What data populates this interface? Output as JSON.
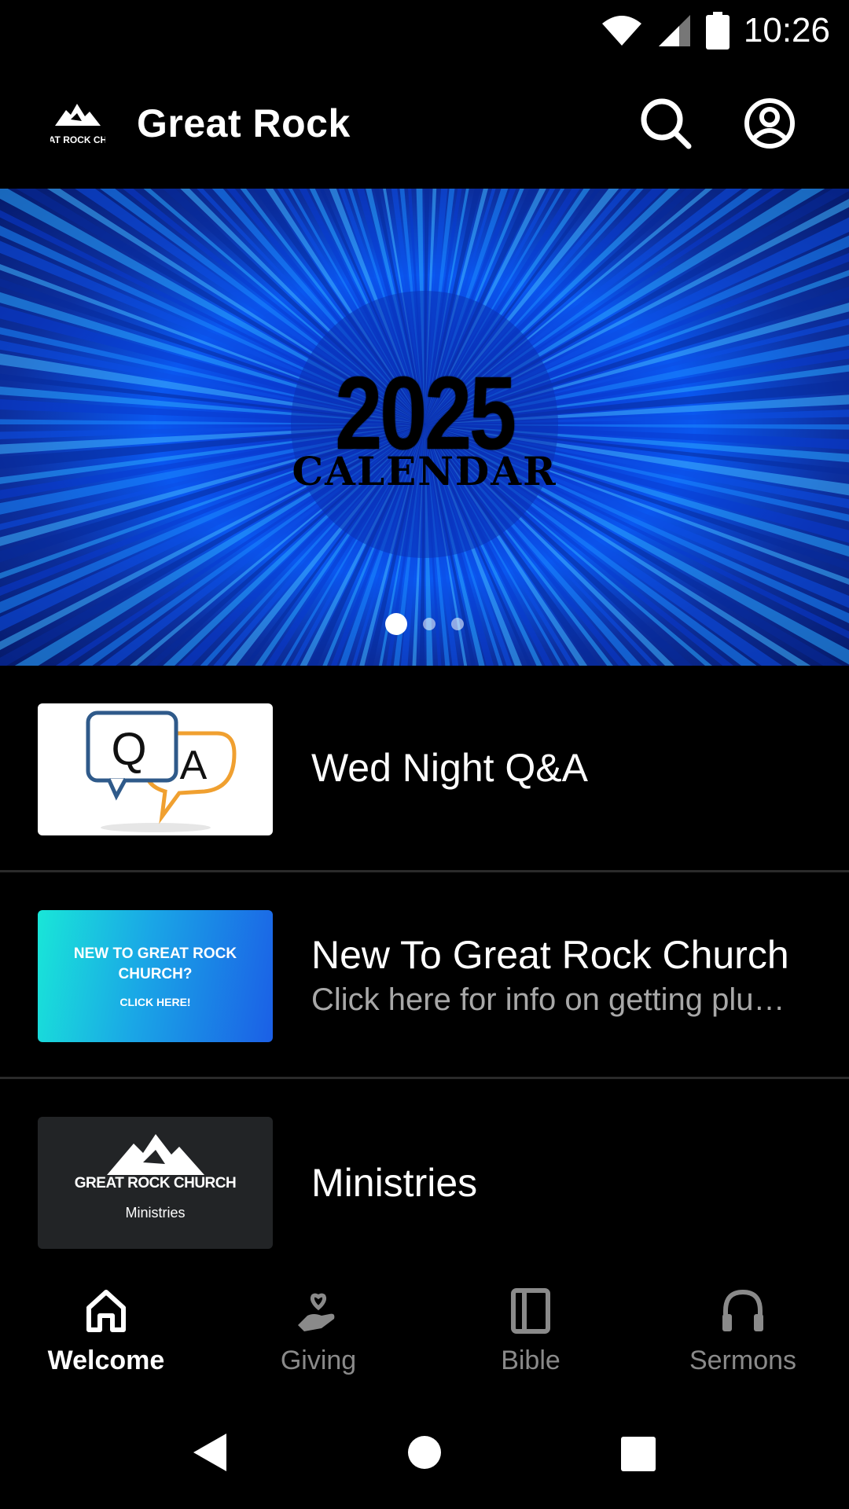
{
  "status_bar": {
    "time": "10:26"
  },
  "app_bar": {
    "title": "Great Rock",
    "logo_text": "AT ROCK CH"
  },
  "hero": {
    "year": "2025",
    "subtitle": "CALENDAR",
    "page_count": 3,
    "active_page": 1
  },
  "list": [
    {
      "title": "Wed Night Q&A",
      "subtitle": "",
      "thumb": {
        "q": "Q",
        "a": "A"
      }
    },
    {
      "title": "New To Great Rock Church",
      "subtitle": "Click here for info on getting plu…",
      "thumb": {
        "line1": "NEW TO GREAT ROCK",
        "line2": "CHURCH?",
        "line3": "CLICK HERE!"
      }
    },
    {
      "title": "Ministries",
      "subtitle": "",
      "thumb": {
        "brand": "GREAT ROCK CHURCH",
        "sub": "Ministries"
      }
    }
  ],
  "bottom_nav": [
    {
      "label": "Welcome",
      "icon": "home-icon",
      "active": true
    },
    {
      "label": "Giving",
      "icon": "giving-hand-heart-icon",
      "active": false
    },
    {
      "label": "Bible",
      "icon": "book-icon",
      "active": false
    },
    {
      "label": "Sermons",
      "icon": "headphones-icon",
      "active": false
    }
  ],
  "colors": {
    "background": "#000000",
    "inactive_nav": "#8a8a8a",
    "hero_blue": "#0a57f0"
  }
}
